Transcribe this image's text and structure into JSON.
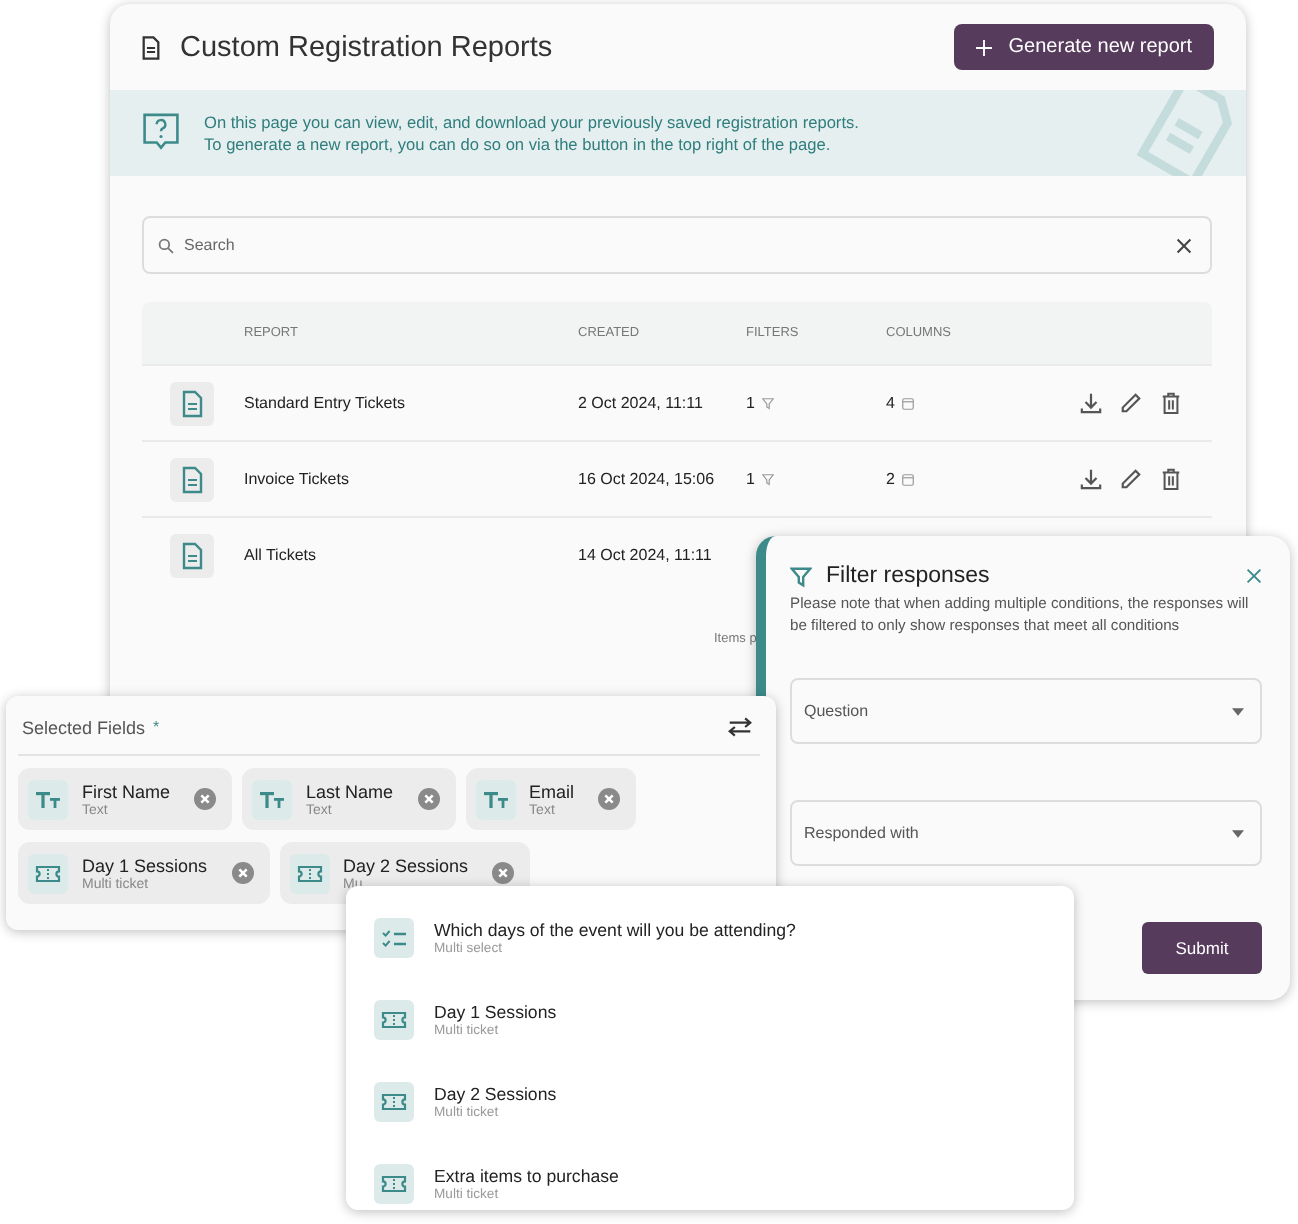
{
  "header": {
    "title": "Custom Registration Reports",
    "action": "Generate new report"
  },
  "info_banner": {
    "lines": [
      "On this page you can view, edit, and download your previously saved registration reports.",
      "To generate a new report, you can do so on via the button in the top right of the page."
    ]
  },
  "search": {
    "placeholder": "Search"
  },
  "table": {
    "columns": [
      "REPORT",
      "CREATED",
      "FILTERS",
      "COLUMNS"
    ],
    "rows": [
      {
        "report": "Standard Entry Tickets",
        "created": "2 Oct 2024, 11:11",
        "filters": "1",
        "columns": "4",
        "actions": true
      },
      {
        "report": "Invoice Tickets",
        "created": "16 Oct 2024, 15:06",
        "filters": "1",
        "columns": "2",
        "actions": true
      },
      {
        "report": "All Tickets",
        "created": "14 Oct 2024, 11:11",
        "actions": false
      }
    ]
  },
  "pagination_fragment": "Items p",
  "filter_panel": {
    "title": "Filter responses",
    "note": "Please note that when adding multiple conditions, the responses will be filtered to only show responses that meet all conditions",
    "fields": [
      {
        "placeholder": "Question"
      },
      {
        "placeholder": "Responded with"
      }
    ],
    "submit": "Submit"
  },
  "selected_fields": {
    "title": "Selected Fields",
    "required_mark": "*",
    "chips": [
      {
        "name": "First Name",
        "type": "Text",
        "kind": "text"
      },
      {
        "name": "Last Name",
        "type": "Text",
        "kind": "text"
      },
      {
        "name": "Email",
        "type": "Text",
        "kind": "text"
      },
      {
        "name": "Day 1 Sessions",
        "type": "Multi ticket",
        "kind": "ticket"
      },
      {
        "name": "Day 2 Sessions",
        "type": "Mu",
        "kind": "ticket"
      }
    ]
  },
  "question_dropdown": {
    "items": [
      {
        "title": "Which days of the event will you be attending?",
        "type": "Multi select",
        "kind": "multi_select"
      },
      {
        "title": "Day 1 Sessions",
        "type": "Multi ticket",
        "kind": "ticket"
      },
      {
        "title": "Day 2 Sessions",
        "type": "Multi ticket",
        "kind": "ticket"
      },
      {
        "title": "Extra items to purchase",
        "type": "Multi ticket",
        "kind": "ticket"
      }
    ]
  }
}
